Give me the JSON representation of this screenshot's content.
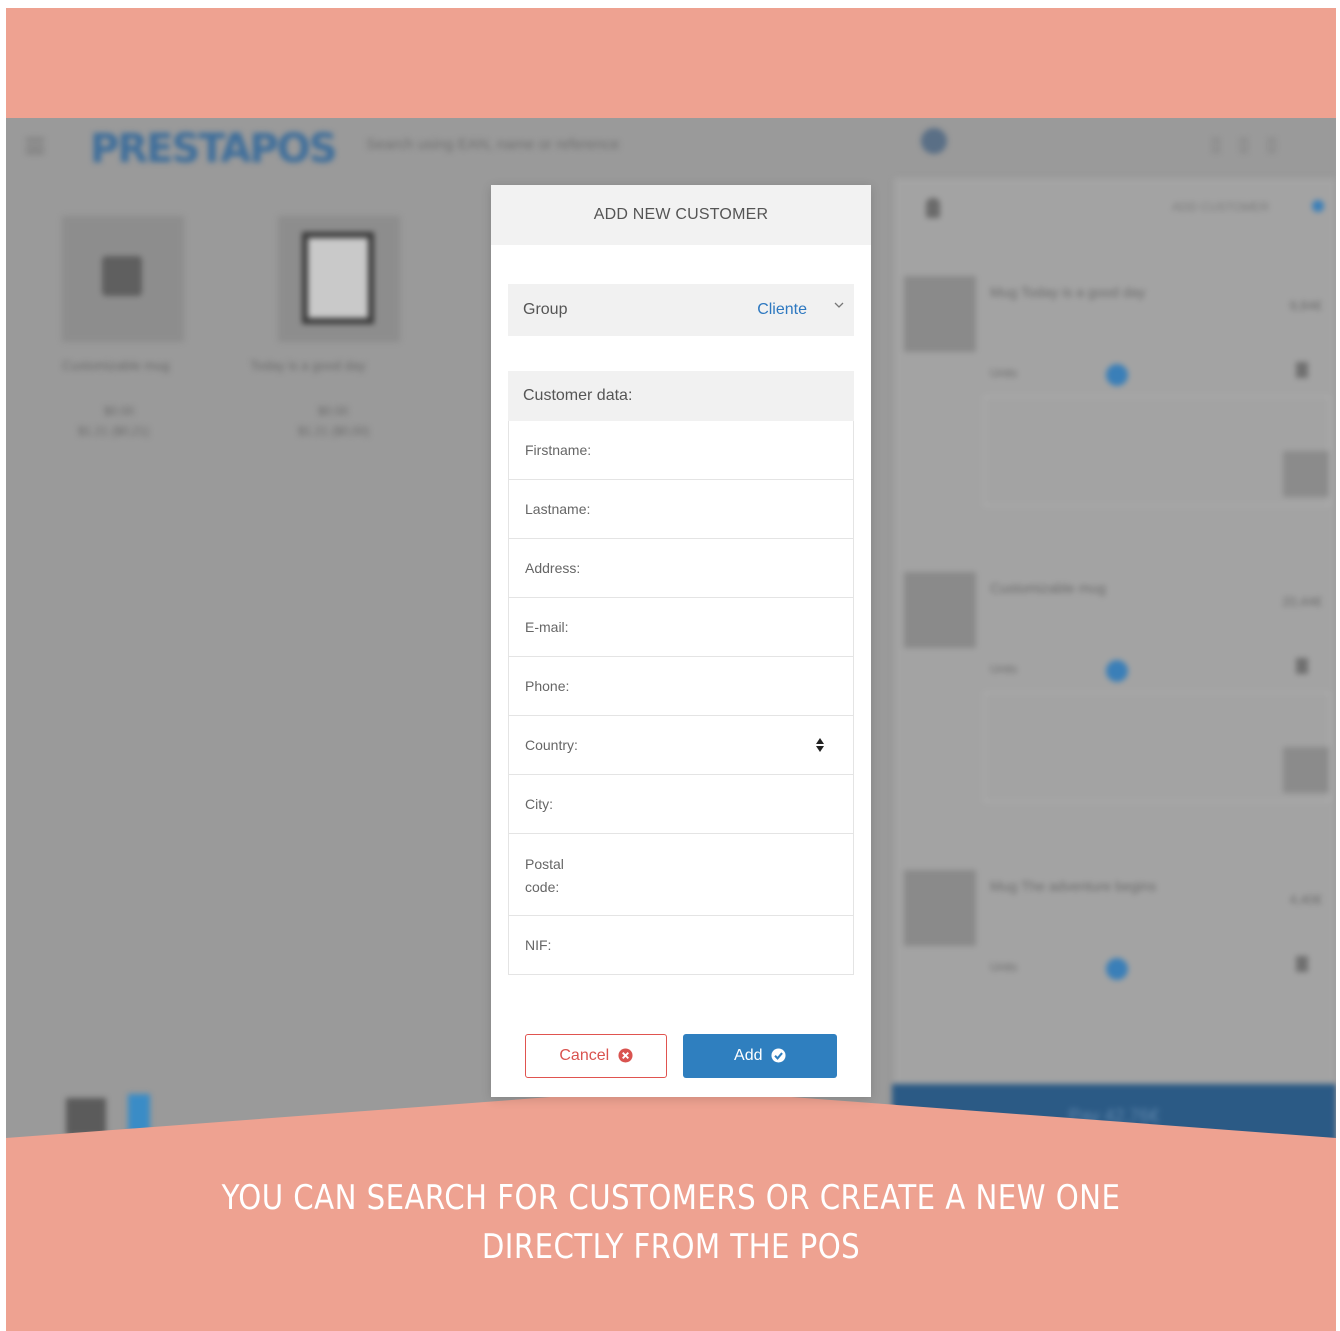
{
  "background_app": {
    "logo": "PRESTAPOS",
    "search_placeholder": "Search using EAN, name or reference",
    "products": [
      {
        "name": "Customizable mug",
        "price": "$0.00",
        "sub": "$1.21 ($0,21)"
      },
      {
        "name": "Today is a good day",
        "price": "$0.00",
        "sub": "$1.21 ($0,00)"
      }
    ],
    "cart": {
      "add_customer": "ADD CUSTOMER",
      "items": [
        {
          "title": "Mug Today is a good day",
          "price": "9,84€"
        },
        {
          "title": "Customizable mug",
          "price": "20,44€"
        },
        {
          "title": "Mug The adventure begins",
          "price": "4,40€"
        }
      ],
      "pay_label": "Pay 42,76€"
    }
  },
  "modal": {
    "title": "ADD NEW CUSTOMER",
    "group": {
      "label": "Group",
      "value": "Cliente"
    },
    "customer_data": {
      "heading": "Customer data:",
      "fields": {
        "firstname": "Firstname:",
        "lastname": "Lastname:",
        "address": "Address:",
        "email": "E-mail:",
        "phone": "Phone:",
        "country": "Country:",
        "city": "City:",
        "postal_code_line1": "Postal",
        "postal_code_line2": "code:",
        "nif": "NIF:"
      }
    },
    "buttons": {
      "cancel": "Cancel",
      "add": "Add"
    }
  },
  "caption": {
    "line1": "YOU CAN SEARCH FOR CUSTOMERS OR CREATE A NEW ONE",
    "line2": "DIRECTLY FROM THE POS"
  },
  "colors": {
    "band": "#eea291",
    "accent_blue": "#2f7fbf",
    "danger_red": "#d9534f",
    "overlay_gray": "#9a9a9a"
  }
}
